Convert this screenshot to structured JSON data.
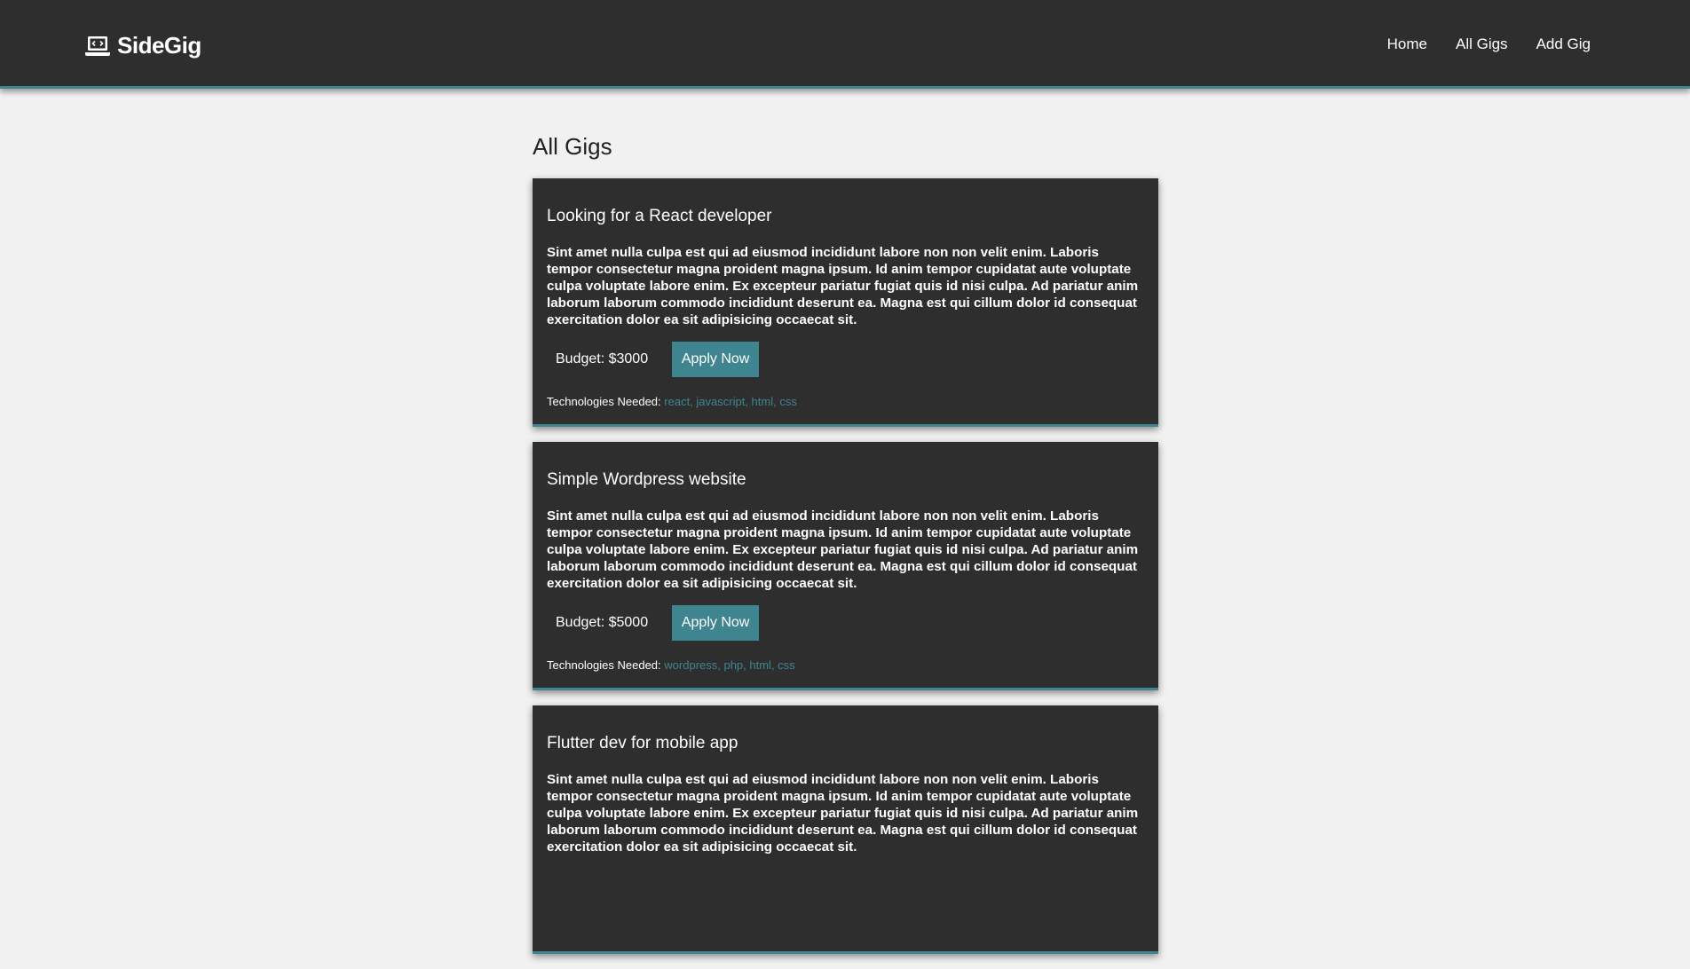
{
  "header": {
    "brand": "SideGig",
    "brand_icon": "laptop-code-icon",
    "nav": [
      "Home",
      "All Gigs",
      "Add Gig"
    ]
  },
  "page_title": "All Gigs",
  "gigs": [
    {
      "title": "Looking for a React developer",
      "description": "Sint amet nulla culpa est qui ad eiusmod incididunt labore non non velit enim. Laboris tempor consectetur magna proident magna ipsum. Id anim tempor cupidatat aute voluptate culpa voluptate labore enim. Ex excepteur pariatur fugiat quis id nisi culpa. Ad pariatur anim laborum laborum commodo incididunt deserunt ea. Magna est qui cillum dolor id consequat exercitation dolor ea sit adipisicing occaecat sit.",
      "budget": "Budget: $3000",
      "apply_label": "Apply Now",
      "tech_label": "Technologies Needed:",
      "technologies": "react, javascript, html, css"
    },
    {
      "title": "Simple Wordpress website",
      "description": "Sint amet nulla culpa est qui ad eiusmod incididunt labore non non velit enim. Laboris tempor consectetur magna proident magna ipsum. Id anim tempor cupidatat aute voluptate culpa voluptate labore enim. Ex excepteur pariatur fugiat quis id nisi culpa. Ad pariatur anim laborum laborum commodo incididunt deserunt ea. Magna est qui cillum dolor id consequat exercitation dolor ea sit adipisicing occaecat sit.",
      "budget": "Budget: $5000",
      "apply_label": "Apply Now",
      "tech_label": "Technologies Needed:",
      "technologies": "wordpress, php, html, css"
    },
    {
      "title": "Flutter dev for mobile app",
      "description": "Sint amet nulla culpa est qui ad eiusmod incididunt labore non non velit enim. Laboris tempor consectetur magna proident magna ipsum. Id anim tempor cupidatat aute voluptate culpa voluptate labore enim. Ex excepteur pariatur fugiat quis id nisi culpa. Ad pariatur anim laborum laborum commodo incididunt deserunt ea. Magna est qui cillum dolor id consequat exercitation dolor ea sit adipisicing occaecat sit."
    }
  ],
  "colors": {
    "header_bg": "#2e2e2e",
    "accent": "#3f8590",
    "page_bg": "#f1f1f1",
    "card_bg": "#2e2e2e"
  }
}
